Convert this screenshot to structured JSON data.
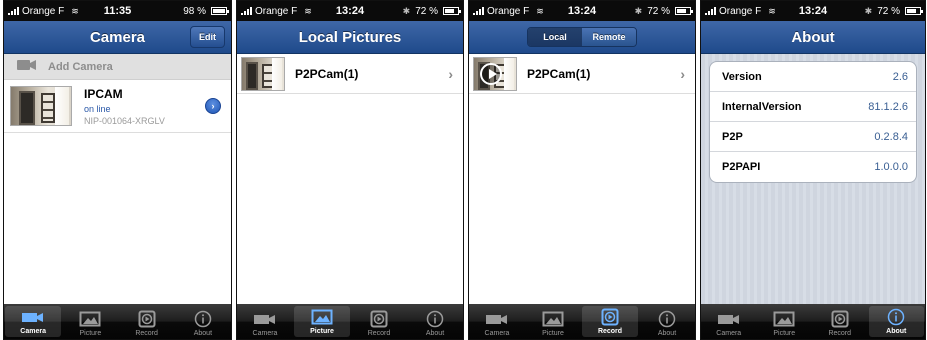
{
  "colors": {
    "navbar": "#2d5a9c",
    "tab_active": "#6db2ff",
    "link_blue": "#2a58a8",
    "about_value": "#3a5f93"
  },
  "screens": [
    {
      "status": {
        "carrier": "Orange F",
        "time": "11:35",
        "battery": "98 %",
        "battery_level": 0.98
      },
      "title": "Camera",
      "edit_label": "Edit",
      "add_camera_label": "Add Camera",
      "cameras": [
        {
          "name": "IPCAM",
          "status": "on line",
          "uid": "NIP-001064-XRGLV"
        }
      ],
      "active_tab": "Camera"
    },
    {
      "status": {
        "carrier": "Orange F",
        "time": "13:24",
        "battery": "72 %",
        "battery_level": 0.72
      },
      "title": "Local Pictures",
      "items": [
        {
          "name": "P2PCam(1)"
        }
      ],
      "active_tab": "Picture"
    },
    {
      "status": {
        "carrier": "Orange F",
        "time": "13:24",
        "battery": "72 %",
        "battery_level": 0.72
      },
      "segments": [
        "Local",
        "Remote"
      ],
      "active_segment": "Local",
      "items": [
        {
          "name": "P2PCam(1)"
        }
      ],
      "active_tab": "Record"
    },
    {
      "status": {
        "carrier": "Orange F",
        "time": "13:24",
        "battery": "72 %",
        "battery_level": 0.72
      },
      "title": "About",
      "info": [
        {
          "key": "Version",
          "value": "2.6"
        },
        {
          "key": "InternalVersion",
          "value": "81.1.2.6"
        },
        {
          "key": "P2P",
          "value": "0.2.8.4"
        },
        {
          "key": "P2PAPI",
          "value": "1.0.0.0"
        }
      ],
      "active_tab": "About"
    }
  ],
  "tabs": [
    {
      "label": "Camera",
      "icon": "camera-icon"
    },
    {
      "label": "Picture",
      "icon": "picture-icon"
    },
    {
      "label": "Record",
      "icon": "record-icon"
    },
    {
      "label": "About",
      "icon": "info-icon"
    }
  ]
}
